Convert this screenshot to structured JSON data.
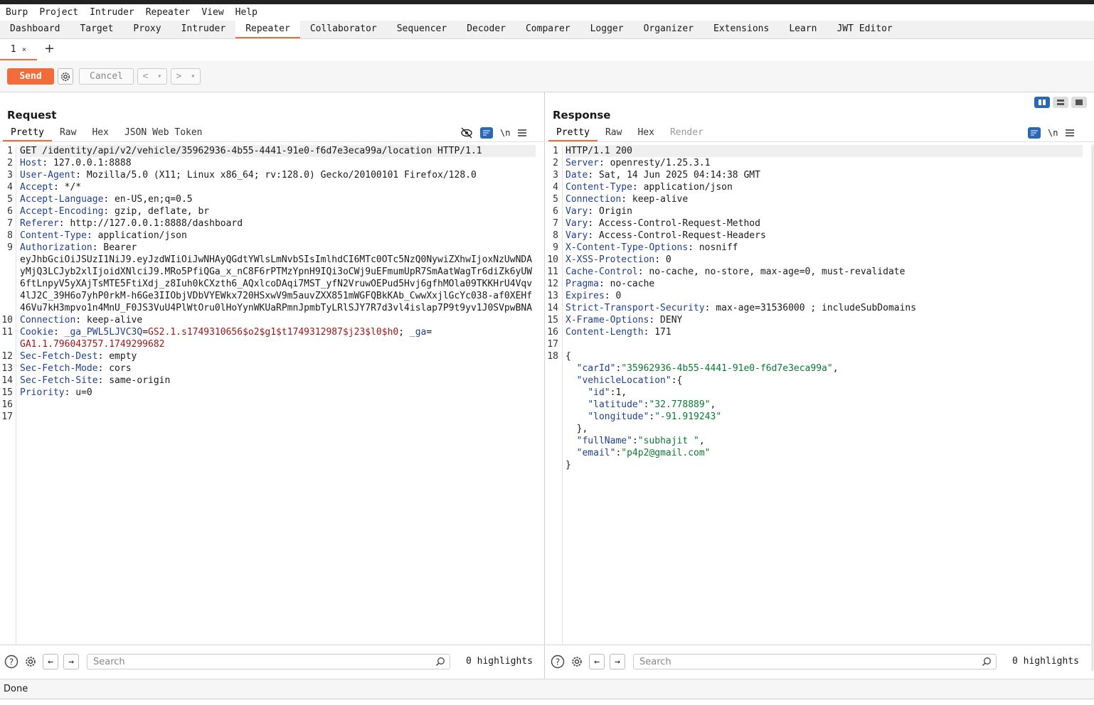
{
  "menu": [
    "Burp",
    "Project",
    "Intruder",
    "Repeater",
    "View",
    "Help"
  ],
  "tabs": [
    "Dashboard",
    "Target",
    "Proxy",
    "Intruder",
    "Repeater",
    "Collaborator",
    "Sequencer",
    "Decoder",
    "Comparer",
    "Logger",
    "Organizer",
    "Extensions",
    "Learn",
    "JWT Editor"
  ],
  "active_tab": "Repeater",
  "repeater_tab": {
    "label": "1",
    "close": "×",
    "add": "+"
  },
  "toolbar": {
    "send": "Send",
    "cancel": "Cancel",
    "prev": "<",
    "next": ">",
    "dropdown": "▾"
  },
  "request": {
    "title": "Request",
    "views": [
      "Pretty",
      "Raw",
      "Hex",
      "JSON Web Token"
    ],
    "active_view": "Pretty",
    "lines": [
      {
        "n": "1",
        "parts": [
          [
            "t",
            "GET /identity/api/v2/vehicle/35962936-4b55-4441-91e0-f6d7e3eca99a/location HTTP/1.1"
          ]
        ],
        "cur": true
      },
      {
        "n": "2",
        "parts": [
          [
            "h",
            "Host"
          ],
          [
            "t",
            ": 127.0.0.1:8888"
          ]
        ]
      },
      {
        "n": "3",
        "parts": [
          [
            "h",
            "User-Agent"
          ],
          [
            "t",
            ": Mozilla/5.0 (X11; Linux x86_64; rv:128.0) Gecko/20100101 Firefox/128.0"
          ]
        ]
      },
      {
        "n": "4",
        "parts": [
          [
            "h",
            "Accept"
          ],
          [
            "t",
            ": */*"
          ]
        ]
      },
      {
        "n": "5",
        "parts": [
          [
            "h",
            "Accept-Language"
          ],
          [
            "t",
            ": en-US,en;q=0.5"
          ]
        ]
      },
      {
        "n": "6",
        "parts": [
          [
            "h",
            "Accept-Encoding"
          ],
          [
            "t",
            ": gzip, deflate, br"
          ]
        ]
      },
      {
        "n": "7",
        "parts": [
          [
            "h",
            "Referer"
          ],
          [
            "t",
            ": http://127.0.0.1:8888/dashboard"
          ]
        ]
      },
      {
        "n": "8",
        "parts": [
          [
            "h",
            "Content-Type"
          ],
          [
            "t",
            ": application/json"
          ]
        ]
      },
      {
        "n": "9",
        "parts": [
          [
            "h",
            "Authorization"
          ],
          [
            "t",
            ": Bearer\neyJhbGciOiJSUzI1NiJ9.eyJzdWIiOiJwNHAyQGdtYWlsLmNvbSIsImlhdCI6MTc0OTc5NzQ0NywiZXhwIjoxNzUwNDAyMjQ3LCJyb2xlIjoidXNlciJ9.MRo5PfiQGa_x_nC8F6rPTMzYpnH9IQi3oCWj9uEFmumUpR7SmAatWagTr6diZk6yUW6ftLnpyV5yXAjTsMTE5FtiXdj_z8Iuh0kCXzth6_AQxlcoDAqi7MST_yfN2VruwOEPud5Hvj6gfhMOla09TKKHrU4Vqv4lJ2C_39H6o7yhP0rkM-h6Ge3IIObjVDbVYEWkx720HSxwV9m5auvZXX851mWGFQBkKAb_CwwXxjlGcYc038-af0XEHf46Vu7kH3mpvo1n4MnU_F0JS3VuU4PlWtOru0lHoYynWKUaRPmnJpmbTyLRlSJY7R7d3vl4islap7P9t9yv1J0SVpwBNA"
          ]
        ]
      },
      {
        "n": "10",
        "parts": [
          [
            "h",
            "Connection"
          ],
          [
            "t",
            ": keep-alive"
          ]
        ]
      },
      {
        "n": "11",
        "parts": [
          [
            "h",
            "Cookie"
          ],
          [
            "t",
            ": "
          ],
          [
            "h",
            "_ga_PWL5LJVC3Q"
          ],
          [
            "t",
            "="
          ],
          [
            "r",
            "GS2.1.s1749310656$o2$g1$t1749312987$j23$l0$h0"
          ],
          [
            "t",
            "; "
          ],
          [
            "h",
            "_ga"
          ],
          [
            "t",
            "=\n"
          ],
          [
            "r",
            "GA1.1.796043757.1749299682"
          ]
        ]
      },
      {
        "n": "12",
        "parts": [
          [
            "h",
            "Sec-Fetch-Dest"
          ],
          [
            "t",
            ": empty"
          ]
        ]
      },
      {
        "n": "13",
        "parts": [
          [
            "h",
            "Sec-Fetch-Mode"
          ],
          [
            "t",
            ": cors"
          ]
        ]
      },
      {
        "n": "14",
        "parts": [
          [
            "h",
            "Sec-Fetch-Site"
          ],
          [
            "t",
            ": same-origin"
          ]
        ]
      },
      {
        "n": "15",
        "parts": [
          [
            "h",
            "Priority"
          ],
          [
            "t",
            ": u=0"
          ]
        ]
      },
      {
        "n": "16",
        "parts": [
          [
            "t",
            ""
          ]
        ]
      },
      {
        "n": "17",
        "parts": [
          [
            "t",
            ""
          ]
        ]
      }
    ],
    "search_placeholder": "Search",
    "highlights": "0 highlights"
  },
  "response": {
    "title": "Response",
    "views": [
      "Pretty",
      "Raw",
      "Hex",
      "Render"
    ],
    "active_view": "Pretty",
    "lines": [
      {
        "n": "1",
        "parts": [
          [
            "t",
            "HTTP/1.1 200"
          ]
        ],
        "cur": true
      },
      {
        "n": "2",
        "parts": [
          [
            "h",
            "Server"
          ],
          [
            "t",
            ": openresty/1.25.3.1"
          ]
        ]
      },
      {
        "n": "3",
        "parts": [
          [
            "h",
            "Date"
          ],
          [
            "t",
            ": Sat, 14 Jun 2025 04:14:38 GMT"
          ]
        ]
      },
      {
        "n": "4",
        "parts": [
          [
            "h",
            "Content-Type"
          ],
          [
            "t",
            ": application/json"
          ]
        ]
      },
      {
        "n": "5",
        "parts": [
          [
            "h",
            "Connection"
          ],
          [
            "t",
            ": keep-alive"
          ]
        ]
      },
      {
        "n": "6",
        "parts": [
          [
            "h",
            "Vary"
          ],
          [
            "t",
            ": Origin"
          ]
        ]
      },
      {
        "n": "7",
        "parts": [
          [
            "h",
            "Vary"
          ],
          [
            "t",
            ": Access-Control-Request-Method"
          ]
        ]
      },
      {
        "n": "8",
        "parts": [
          [
            "h",
            "Vary"
          ],
          [
            "t",
            ": Access-Control-Request-Headers"
          ]
        ]
      },
      {
        "n": "9",
        "parts": [
          [
            "h",
            "X-Content-Type-Options"
          ],
          [
            "t",
            ": nosniff"
          ]
        ]
      },
      {
        "n": "10",
        "parts": [
          [
            "h",
            "X-XSS-Protection"
          ],
          [
            "t",
            ": 0"
          ]
        ]
      },
      {
        "n": "11",
        "parts": [
          [
            "h",
            "Cache-Control"
          ],
          [
            "t",
            ": no-cache, no-store, max-age=0, must-revalidate"
          ]
        ]
      },
      {
        "n": "12",
        "parts": [
          [
            "h",
            "Pragma"
          ],
          [
            "t",
            ": no-cache"
          ]
        ]
      },
      {
        "n": "13",
        "parts": [
          [
            "h",
            "Expires"
          ],
          [
            "t",
            ": 0"
          ]
        ]
      },
      {
        "n": "14",
        "parts": [
          [
            "h",
            "Strict-Transport-Security"
          ],
          [
            "t",
            ": max-age=31536000 ; includeSubDomains"
          ]
        ]
      },
      {
        "n": "15",
        "parts": [
          [
            "h",
            "X-Frame-Options"
          ],
          [
            "t",
            ": DENY"
          ]
        ]
      },
      {
        "n": "16",
        "parts": [
          [
            "h",
            "Content-Length"
          ],
          [
            "t",
            ": 171"
          ]
        ]
      },
      {
        "n": "17",
        "parts": [
          [
            "t",
            ""
          ]
        ]
      },
      {
        "n": "18",
        "parts": [
          [
            "t",
            "{"
          ]
        ]
      },
      {
        "n": "",
        "parts": [
          [
            "t",
            "  "
          ],
          [
            "h",
            "\"carId\""
          ],
          [
            "t",
            ":"
          ],
          [
            "g",
            "\"35962936-4b55-4441-91e0-f6d7e3eca99a\""
          ],
          [
            "t",
            ","
          ]
        ]
      },
      {
        "n": "",
        "parts": [
          [
            "t",
            "  "
          ],
          [
            "h",
            "\"vehicleLocation\""
          ],
          [
            "t",
            ":{"
          ]
        ]
      },
      {
        "n": "",
        "parts": [
          [
            "t",
            "    "
          ],
          [
            "h",
            "\"id\""
          ],
          [
            "t",
            ":1,"
          ]
        ]
      },
      {
        "n": "",
        "parts": [
          [
            "t",
            "    "
          ],
          [
            "h",
            "\"latitude\""
          ],
          [
            "t",
            ":"
          ],
          [
            "g",
            "\"32.778889\""
          ],
          [
            "t",
            ","
          ]
        ]
      },
      {
        "n": "",
        "parts": [
          [
            "t",
            "    "
          ],
          [
            "h",
            "\"longitude\""
          ],
          [
            "t",
            ":"
          ],
          [
            "g",
            "\"-91.919243\""
          ]
        ]
      },
      {
        "n": "",
        "parts": [
          [
            "t",
            "  },"
          ]
        ]
      },
      {
        "n": "",
        "parts": [
          [
            "t",
            "  "
          ],
          [
            "h",
            "\"fullName\""
          ],
          [
            "t",
            ":"
          ],
          [
            "g",
            "\"subhajit \""
          ],
          [
            "t",
            ","
          ]
        ]
      },
      {
        "n": "",
        "parts": [
          [
            "t",
            "  "
          ],
          [
            "h",
            "\"email\""
          ],
          [
            "t",
            ":"
          ],
          [
            "g",
            "\"p4p2@gmail.com\""
          ]
        ]
      },
      {
        "n": "",
        "parts": [
          [
            "t",
            "}"
          ]
        ]
      }
    ],
    "search_placeholder": "Search",
    "highlights": "0 highlights"
  },
  "status": "Done",
  "colors": {
    "accent": "#f26b3a",
    "header_name": "#1f3f8f",
    "value_red": "#a31515",
    "json_string": "#0a7a33",
    "toggle_blue": "#2a68b3"
  }
}
